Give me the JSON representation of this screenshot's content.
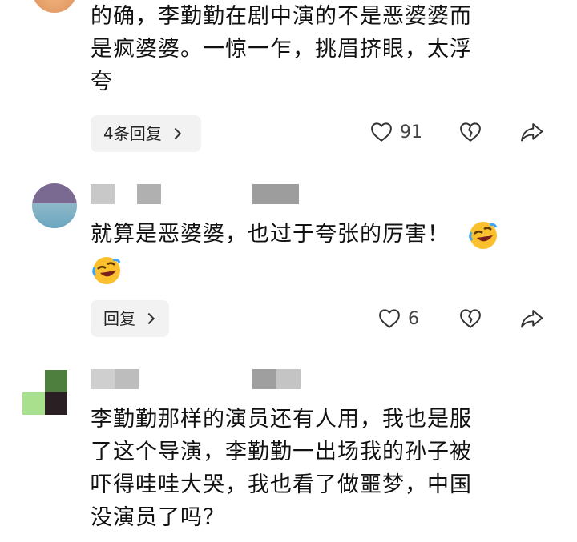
{
  "comments": [
    {
      "text_lines": [
        "的确，李勤勤在剧中演的不是恶婆婆而",
        "是疯婆婆。一惊一乍，挑眉挤眼，太浮",
        "夸"
      ],
      "reply_label": "4条回复",
      "likes": "91"
    },
    {
      "text_lines": [
        "就算是恶婆婆，也过于夸张的厉害！"
      ],
      "reply_label": "回复",
      "likes": "6"
    },
    {
      "text_lines": [
        "李勤勤那样的演员还有人用，我也是服",
        "了这个导演，李勤勤一出场我的孙子被",
        "吓得哇哇大哭，我也看了做噩梦，中国",
        "没演员了吗？"
      ]
    }
  ],
  "icons": {
    "like": "heart-outline-icon",
    "dislike": "broken-heart-icon",
    "share": "share-arrow-icon",
    "emoji": "rolling-laughing-emoji"
  }
}
